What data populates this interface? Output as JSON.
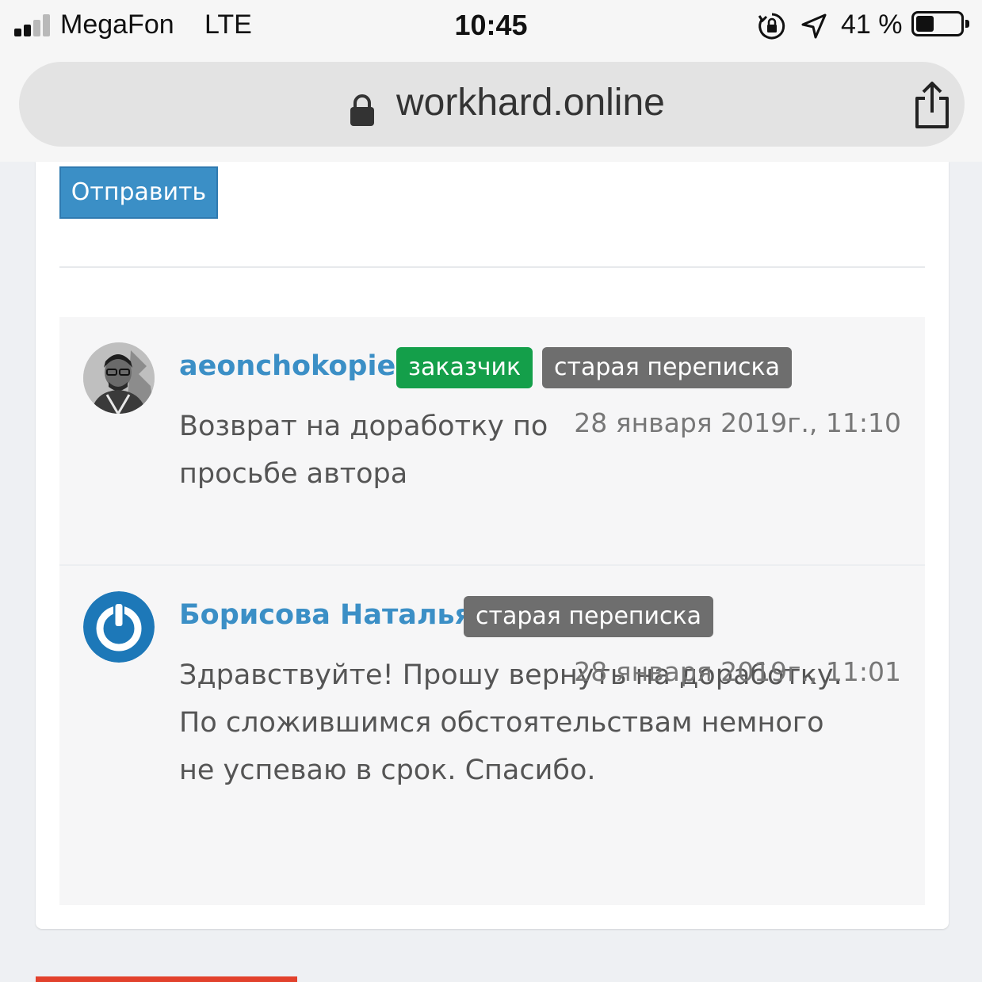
{
  "status_bar": {
    "carrier": "MegaFon",
    "network": "LTE",
    "time": "10:45",
    "battery_percent": "41 %",
    "battery_level": 0.41,
    "icons": [
      "signal-icon",
      "rotation-lock-icon",
      "location-arrow-icon",
      "battery-icon"
    ]
  },
  "browser": {
    "url": "workhard.online",
    "icons": [
      "lock-icon",
      "share-icon"
    ]
  },
  "form": {
    "submit_label": "Отправить",
    "submit_color": "#3b8fc6"
  },
  "comments": [
    {
      "author": "aeonchokopie",
      "badges": [
        "заказчик",
        "старая переписка"
      ],
      "text": "Возврат на доработку по просьбе автора",
      "timestamp": "28 января 2019г., 11:10"
    },
    {
      "author": "Борисова Наталья",
      "badges": [
        "старая переписка"
      ],
      "text": "Здравствуйте! Прошу вернуть на доработку. По сложившимся обстоятельствам немного не успеваю в срок. Спасибо.",
      "timestamp": "28 января 2019г., 11:01"
    }
  ],
  "colors": {
    "author_link": "#3b8fc6",
    "badge_customer": "#149f4a",
    "badge_old": "#6e6e6e",
    "accent_bottom": "#e2412c"
  }
}
